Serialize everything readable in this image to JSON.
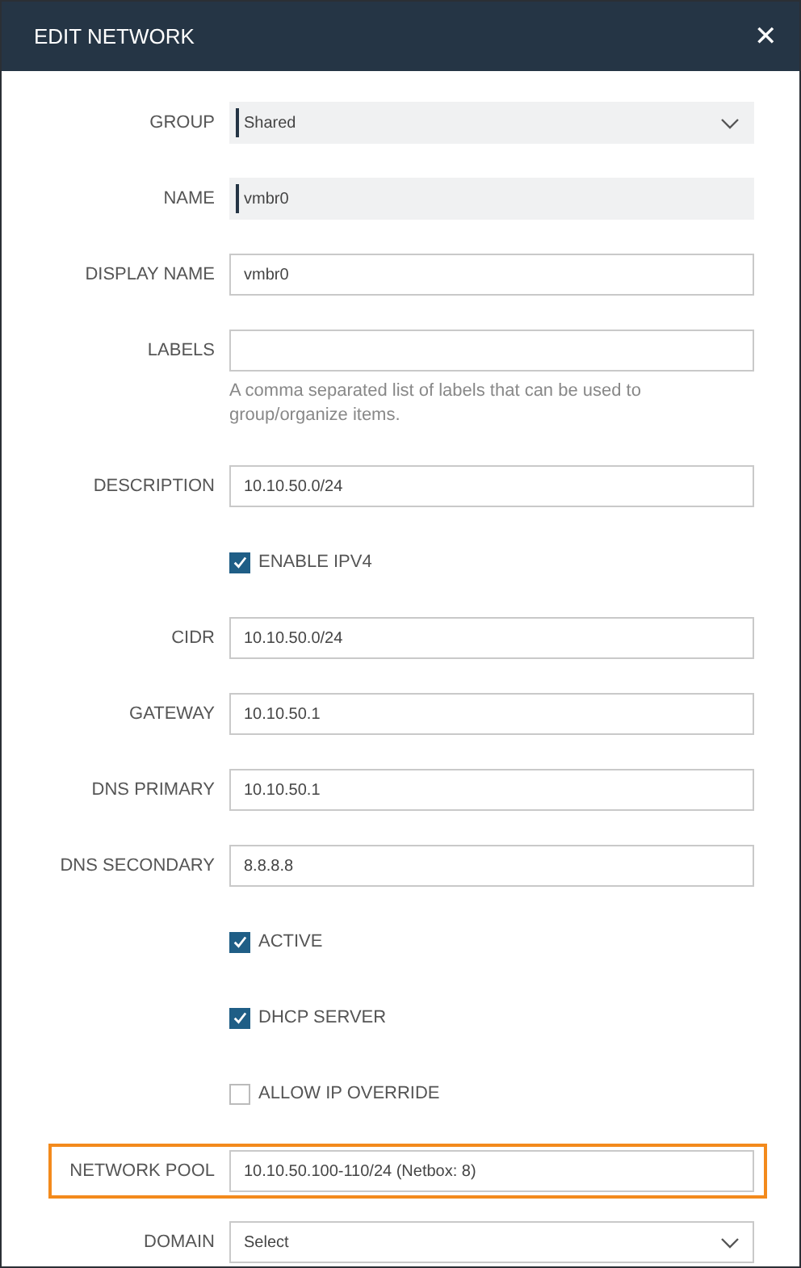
{
  "window": {
    "title": "EDIT NETWORK",
    "close": "✕"
  },
  "fields": [
    {
      "kind": "select",
      "label": "GROUP",
      "value": "Shared"
    },
    {
      "kind": "readonly",
      "label": "NAME",
      "value": "vmbr0"
    },
    {
      "kind": "text",
      "label": "DISPLAY NAME",
      "value": "vmbr0"
    },
    {
      "kind": "text",
      "label": "LABELS",
      "help": "A comma separated list of labels that can be used to group/organize items."
    },
    {
      "kind": "text",
      "label": "DESCRIPTION",
      "value": "10.10.50.0/24"
    },
    {
      "kind": "checkbox",
      "label": "ENABLE IPV4",
      "checked": true
    },
    {
      "kind": "text",
      "label": "CIDR",
      "value": "10.10.50.0/24"
    },
    {
      "kind": "text",
      "label": "GATEWAY",
      "value": "10.10.50.1"
    },
    {
      "kind": "text",
      "label": "DNS PRIMARY",
      "value": "10.10.50.1"
    },
    {
      "kind": "text",
      "label": "DNS SECONDARY",
      "value": "8.8.8.8"
    },
    {
      "kind": "checkbox",
      "label": "ACTIVE",
      "checked": true
    },
    {
      "kind": "checkbox",
      "label": "DHCP SERVER",
      "checked": true
    },
    {
      "kind": "checkbox",
      "label": "ALLOW IP OVERRIDE",
      "checked": false
    },
    {
      "kind": "text",
      "label": "NETWORK POOL",
      "value": "10.10.50.100-110/24 (Netbox: 8)",
      "highlighted": true
    },
    {
      "kind": "select",
      "label": "DOMAIN",
      "value": "Select"
    }
  ]
}
